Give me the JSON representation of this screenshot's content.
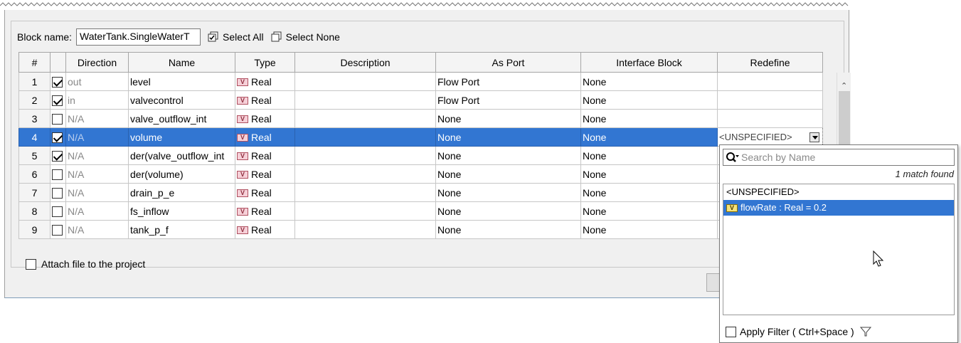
{
  "topbar": {
    "block_label": "Block name:",
    "block_value": "WaterTank.SingleWaterT",
    "select_all": "Select All",
    "select_none": "Select None"
  },
  "columns": [
    "#",
    "",
    "Direction",
    "Name",
    "Type",
    "Description",
    "As Port",
    "Interface Block",
    "Redefine"
  ],
  "rows": [
    {
      "num": "1",
      "checked": true,
      "direction": "out",
      "name": "level",
      "type": "Real",
      "description": "",
      "as_port": "Flow Port",
      "interface_block": "None",
      "redefine": ""
    },
    {
      "num": "2",
      "checked": true,
      "direction": "in",
      "name": "valvecontrol",
      "type": "Real",
      "description": "",
      "as_port": "Flow Port",
      "interface_block": "None",
      "redefine": ""
    },
    {
      "num": "3",
      "checked": false,
      "direction": "N/A",
      "name": "valve_outflow_int",
      "type": "Real",
      "description": "",
      "as_port": "None",
      "interface_block": "None",
      "redefine": ""
    },
    {
      "num": "4",
      "checked": true,
      "direction": "N/A",
      "name": "volume",
      "type": "Real",
      "description": "",
      "as_port": "None",
      "interface_block": "None",
      "redefine": "<UNSPECIFIED>",
      "selected": true
    },
    {
      "num": "5",
      "checked": true,
      "direction": "N/A",
      "name": "der(valve_outflow_int",
      "type": "Real",
      "description": "",
      "as_port": "None",
      "interface_block": "None",
      "redefine": ""
    },
    {
      "num": "6",
      "checked": false,
      "direction": "N/A",
      "name": "der(volume)",
      "type": "Real",
      "description": "",
      "as_port": "None",
      "interface_block": "None",
      "redefine": ""
    },
    {
      "num": "7",
      "checked": false,
      "direction": "N/A",
      "name": "drain_p_e",
      "type": "Real",
      "description": "",
      "as_port": "None",
      "interface_block": "None",
      "redefine": ""
    },
    {
      "num": "8",
      "checked": false,
      "direction": "N/A",
      "name": "fs_inflow",
      "type": "Real",
      "description": "",
      "as_port": "None",
      "interface_block": "None",
      "redefine": ""
    },
    {
      "num": "9",
      "checked": false,
      "direction": "N/A",
      "name": "tank_p_f",
      "type": "Real",
      "description": "",
      "as_port": "None",
      "interface_block": "None",
      "redefine": ""
    }
  ],
  "attach_label": "Attach file to the project",
  "popup": {
    "search_placeholder": "Search by Name",
    "match_text": "1 match found",
    "items": [
      "<UNSPECIFIED>",
      "flowRate : Real = 0.2"
    ],
    "filter_label": "Apply Filter ( Ctrl+Space )"
  },
  "colors": {
    "selection": "#3276d2",
    "value_icon": "#f6d0d8"
  }
}
